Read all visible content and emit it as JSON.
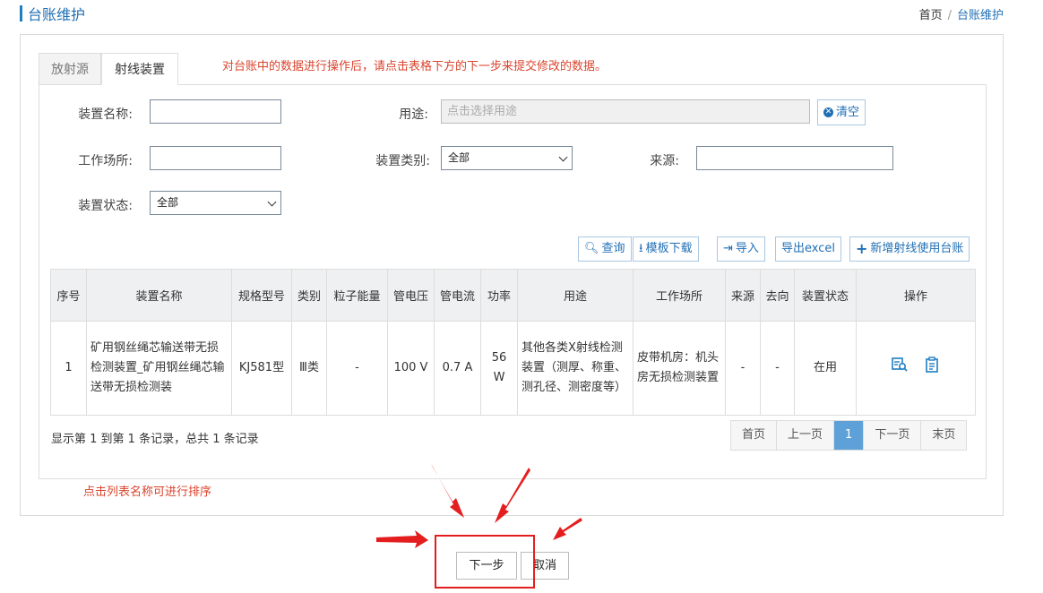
{
  "header": {
    "title": "台账维护",
    "breadcrumb_home": "首页",
    "breadcrumb_sep": "/",
    "breadcrumb_current": "台账维护"
  },
  "tabs": [
    {
      "label": "放射源"
    },
    {
      "label": "射线装置"
    }
  ],
  "notice": "对台账中的数据进行操作后，请点击表格下方的下一步来提交修改的数据。",
  "form": {
    "name_label": "装置名称:",
    "name_value": "",
    "usage_label": "用途:",
    "usage_placeholder": "点击选择用途",
    "clear_label": "清空",
    "site_label": "工作场所:",
    "site_value": "",
    "category_label": "装置类别:",
    "category_value": "全部",
    "source_label": "来源:",
    "source_value": "",
    "status_label": "装置状态:",
    "status_value": "全部"
  },
  "toolbar": {
    "query": "查询",
    "template": "模板下载",
    "import": "导入",
    "export": "导出excel",
    "add": "新增射线使用台账"
  },
  "table": {
    "columns": [
      "序号",
      "装置名称",
      "规格型号",
      "类别",
      "粒子能量",
      "管电压",
      "管电流",
      "功率",
      "用途",
      "工作场所",
      "来源",
      "去向",
      "装置状态",
      "操作"
    ],
    "rows": [
      {
        "index": "1",
        "name": "矿用钢丝绳芯输送带无损检测装置_矿用钢丝绳芯输送带无损检测装",
        "model": "KJ581型",
        "category": "Ⅲ类",
        "energy": "-",
        "voltage": "100 V",
        "current": "0.7 A",
        "power": "56 W",
        "usage": "其他各类X射线检测装置（测厚、称重、测孔径、测密度等）",
        "site": "皮带机房：机头房无损检测装置",
        "source": "-",
        "dest": "-",
        "status": "在用"
      }
    ]
  },
  "pagination": {
    "summary": "显示第 1 到第 1 条记录，总共 1 条记录",
    "first": "首页",
    "prev": "上一页",
    "current": "1",
    "next": "下一页",
    "last": "末页"
  },
  "sort_hint": "点击列表名称可进行排序",
  "actions": {
    "next": "下一步",
    "cancel": "取消"
  },
  "colors": {
    "accent": "#1f6fb5",
    "notice": "#d9442d",
    "highlight": "#e41e1e"
  }
}
